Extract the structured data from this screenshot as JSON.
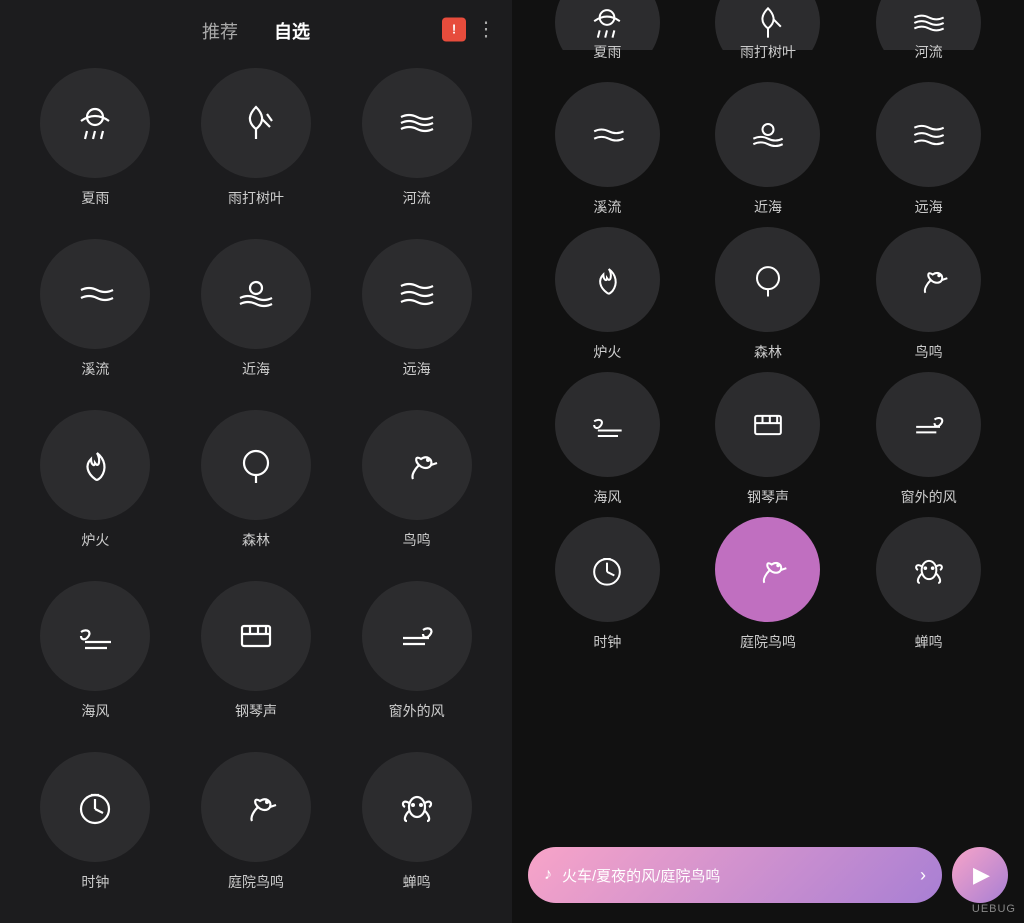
{
  "header": {
    "tab1": "推荐",
    "tab2": "自选",
    "alert_icon": "!",
    "more_icon": "⋮"
  },
  "left_sounds": [
    {
      "id": "xia_yu",
      "label": "夏雨",
      "icon": "rain"
    },
    {
      "id": "yu_da_shu_ye",
      "label": "雨打树叶",
      "icon": "leaf_rain"
    },
    {
      "id": "he_liu",
      "label": "河流",
      "icon": "river"
    },
    {
      "id": "xi_liu",
      "label": "溪流",
      "icon": "stream"
    },
    {
      "id": "jin_hai",
      "label": "近海",
      "icon": "near_sea"
    },
    {
      "id": "yuan_hai",
      "label": "远海",
      "icon": "far_sea"
    },
    {
      "id": "lu_huo",
      "label": "炉火",
      "icon": "fire"
    },
    {
      "id": "sen_lin",
      "label": "森林",
      "icon": "tree"
    },
    {
      "id": "niao_ming",
      "label": "鸟鸣",
      "icon": "bird"
    },
    {
      "id": "hai_feng",
      "label": "海风",
      "icon": "wind"
    },
    {
      "id": "gang_qin_sheng",
      "label": "钢琴声",
      "icon": "piano"
    },
    {
      "id": "chuang_wai_de_feng",
      "label": "窗外的风",
      "icon": "wind2"
    },
    {
      "id": "shi_zhong",
      "label": "时钟",
      "icon": "clock"
    },
    {
      "id": "ting_yuan_niao_ming",
      "label": "庭院鸟鸣",
      "icon": "bird2"
    },
    {
      "id": "chan_ming",
      "label": "蝉鸣",
      "icon": "cicada"
    }
  ],
  "right_sounds": [
    {
      "id": "xia_yu_r",
      "label": "夏雨",
      "icon": "rain",
      "partial": true
    },
    {
      "id": "yu_da_shu_ye_r",
      "label": "雨打树叶",
      "icon": "leaf_rain",
      "partial": true
    },
    {
      "id": "he_liu_r",
      "label": "河流",
      "icon": "river",
      "partial": true
    },
    {
      "id": "xi_liu_r",
      "label": "溪流",
      "icon": "stream"
    },
    {
      "id": "jin_hai_r",
      "label": "近海",
      "icon": "near_sea"
    },
    {
      "id": "yuan_hai_r",
      "label": "远海",
      "icon": "far_sea"
    },
    {
      "id": "lu_huo_r",
      "label": "炉火",
      "icon": "fire"
    },
    {
      "id": "sen_lin_r",
      "label": "森林",
      "icon": "tree"
    },
    {
      "id": "niao_ming_r",
      "label": "鸟鸣",
      "icon": "bird"
    },
    {
      "id": "hai_feng_r",
      "label": "海风",
      "icon": "wind"
    },
    {
      "id": "gang_qin_sheng_r",
      "label": "钢琴声",
      "icon": "piano"
    },
    {
      "id": "chuang_wai_de_feng_r",
      "label": "窗外的风",
      "icon": "wind2"
    },
    {
      "id": "shi_zhong_r",
      "label": "时钟",
      "icon": "clock"
    },
    {
      "id": "ting_yuan_niao_ming_r",
      "label": "庭院鸟鸣",
      "icon": "bird2",
      "active": true
    },
    {
      "id": "chan_ming_r",
      "label": "蝉鸣",
      "icon": "cicada"
    }
  ],
  "bottom_bar": {
    "now_playing": "火车/夏夜的风/庭院鸟鸣",
    "play_label": "▶"
  },
  "watermark": "UEBUG"
}
